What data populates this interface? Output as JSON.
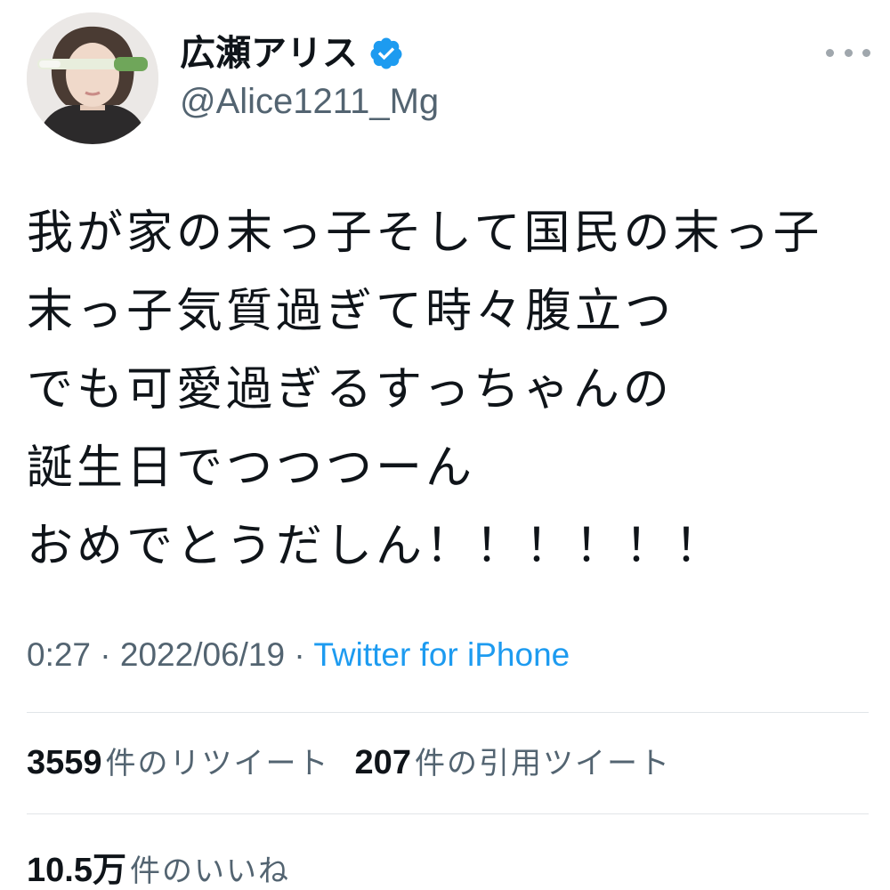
{
  "user": {
    "display_name": "広瀬アリス",
    "handle": "@Alice1211_Mg",
    "verified": true
  },
  "tweet": {
    "lines": [
      "我が家の末っ子そして国民の末っ子",
      "末っ子気質過ぎて時々腹立つ",
      "でも可愛過ぎるすっちゃんの",
      "誕生日でつつつーん",
      "おめでとうだしん！！！！！！"
    ],
    "time": "0:27",
    "date": "2022/06/19",
    "separator": "·",
    "source": "Twitter for iPhone"
  },
  "stats": {
    "retweets_count": "3559",
    "retweets_label": "件のリツイート",
    "quotes_count": "207",
    "quotes_label": "件の引用ツイート",
    "likes_count": "10.5万",
    "likes_label": "件のいいね"
  },
  "colors": {
    "text": "#0f1419",
    "secondary": "#536471",
    "link": "#1d9bf0",
    "verified": "#1d9bf0",
    "divider": "#e1e5e8"
  },
  "icons": {
    "verified": "verified-badge-icon",
    "more": "more-options-icon"
  }
}
